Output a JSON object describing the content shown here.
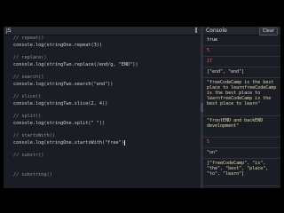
{
  "editor": {
    "title": "JS",
    "lines": [
      {
        "comment": "// repeat()",
        "code": null
      },
      {
        "comment": null,
        "code": "console.log(stringOne.repeat(3))"
      },
      {
        "comment": "// replace()",
        "code": null
      },
      {
        "comment": null,
        "code": "console.log(stringTwo.replace(/end/g, \"END\"))"
      },
      {
        "comment": "// search()",
        "code": null
      },
      {
        "comment": null,
        "code": "console.log(stringTwo.search(\"end\"))"
      },
      {
        "comment": "// slice()",
        "code": null
      },
      {
        "comment": null,
        "code": "console.log(stringTwo.slice(2, 4))"
      },
      {
        "comment": "// split()",
        "code": null
      },
      {
        "comment": null,
        "code": "console.log(stringOne.split(\" \"))"
      },
      {
        "comment": "// startsWith()",
        "code": null
      },
      {
        "comment": null,
        "code": "console.log(stringOne.startsWith(\"free\")"
      },
      {
        "comment": "// substr()",
        "code": null
      },
      {
        "comment": "// substring()",
        "code": null
      }
    ]
  },
  "console": {
    "title": "Console",
    "clear_label": "Clear",
    "outputs": [
      {
        "text": "true",
        "kind": "bool"
      },
      {
        "text": "5",
        "kind": "num"
      },
      {
        "text": "17",
        "kind": "num"
      },
      {
        "text": "[\"end\", \"end\"]",
        "kind": "str"
      },
      {
        "text": "\"freeCodeCamp is the best place to learnfreeCodeCamp is the best place to learnfreeCodeCamp is the best place to learn\"",
        "kind": "str"
      },
      {
        "text": "\"frontEND and backEND development\"",
        "kind": "str"
      },
      {
        "text": "5",
        "kind": "num"
      },
      {
        "text": "\"on\"",
        "kind": "str"
      },
      {
        "text": "[\"freeCodeCamp\", \"is\", \"the\", \"best\", \"place\", \"to\", \"learn\"]",
        "kind": "str"
      }
    ]
  },
  "colors": {
    "background": "#000000",
    "panel": "#1b1d24",
    "header": "#23262f",
    "number_output": "#ff5b52",
    "string_output": "#e8d8b0",
    "string_literal": "#e8d46a"
  }
}
